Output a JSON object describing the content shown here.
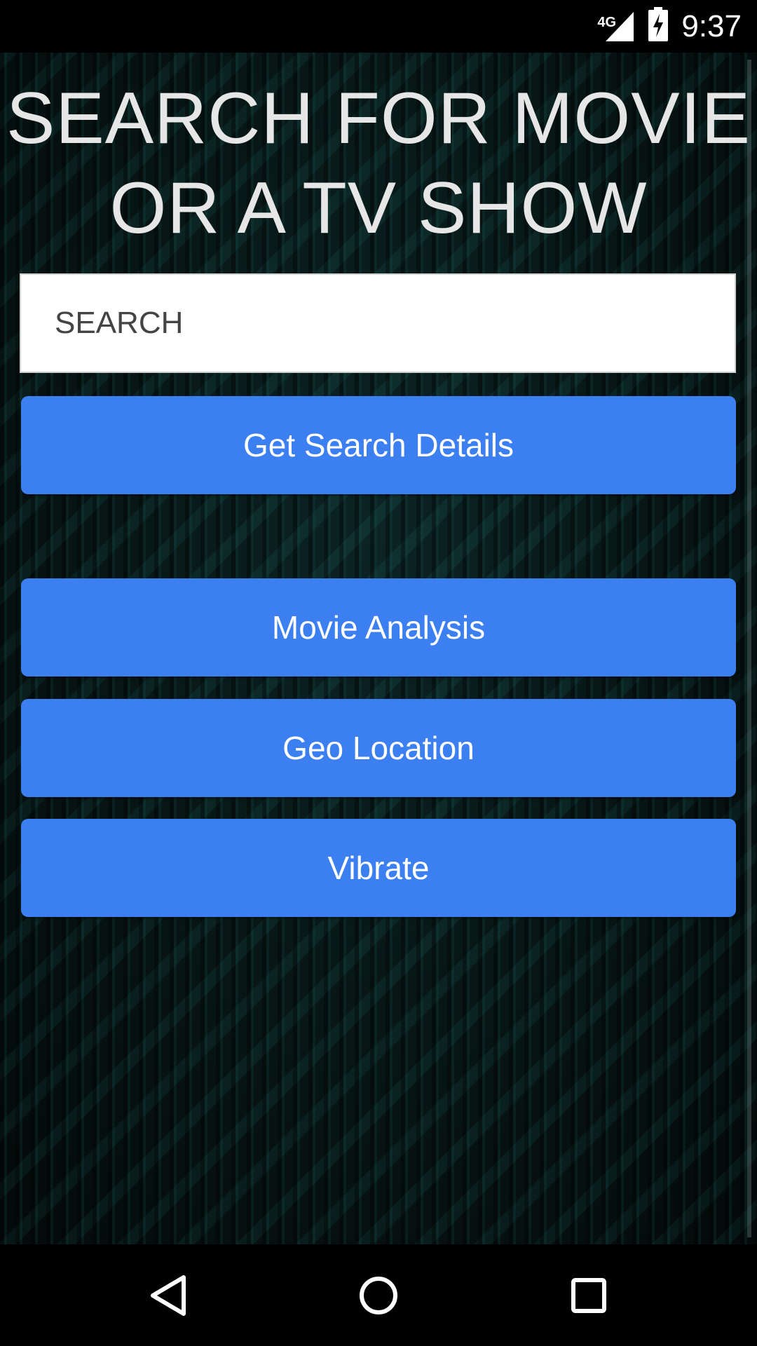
{
  "status_bar": {
    "network": "4G",
    "time": "9:37"
  },
  "main": {
    "heading_line1": "SEARCH FOR MOVIE",
    "heading_line2": "OR A TV SHOW",
    "search": {
      "placeholder": "SEARCH",
      "value": ""
    },
    "buttons": {
      "get_search_details": "Get Search Details",
      "movie_analysis": "Movie Analysis",
      "geo_location": "Geo Location",
      "vibrate": "Vibrate"
    }
  },
  "nav_bar": {
    "back": "back-icon",
    "home": "home-icon",
    "recents": "recents-icon"
  },
  "colors": {
    "button": "#3b7ff0",
    "heading_text": "#e6e6e6",
    "background": "#081817"
  }
}
